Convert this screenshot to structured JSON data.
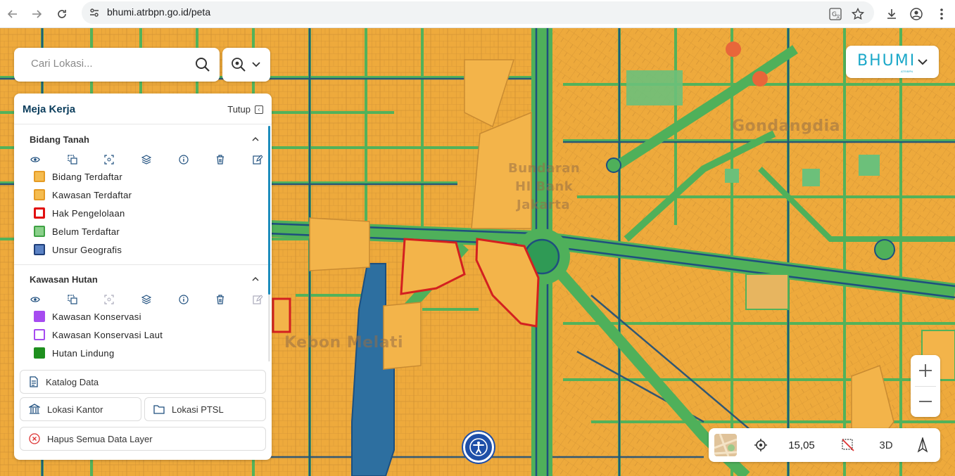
{
  "browser": {
    "url": "bhumi.atrbpn.go.id/peta"
  },
  "search": {
    "placeholder": "Cari Lokasi..."
  },
  "panel": {
    "title": "Meja Kerja",
    "close_label": "Tutup",
    "sections": [
      {
        "title": "Bidang Tanah",
        "items": [
          {
            "label": "Bidang Terdaftar",
            "color": "#f5bc4f",
            "border": "#e59b25"
          },
          {
            "label": "Kawasan Terdaftar",
            "color": "#f5bc4f",
            "border": "#e59b25"
          },
          {
            "label": "Hak Pengelolaan",
            "color": "#ffffff",
            "border": "#e10f0f"
          },
          {
            "label": "Belum Terdaftar",
            "color": "#8ad08a",
            "border": "#3fa244"
          },
          {
            "label": "Unsur Geografis",
            "color": "#5b82c4",
            "border": "#1f3f7a"
          }
        ]
      },
      {
        "title": "Kawasan Hutan",
        "items": [
          {
            "label": "Kawasan Konservasi",
            "color": "#a64bf0",
            "border": "#a64bf0"
          },
          {
            "label": "Kawasan Konservasi Laut",
            "color": "#ffffff",
            "border": "#a64bf0"
          },
          {
            "label": "Hutan Lindung",
            "color": "#1e8f1e",
            "border": "#1e8f1e"
          }
        ]
      }
    ],
    "buttons": {
      "katalog": "Katalog Data",
      "kantor": "Lokasi Kantor",
      "ptsl": "Lokasi PTSL",
      "hapus": "Hapus Semua Data Layer"
    }
  },
  "brand": {
    "name": "BHUMI",
    "sub": "ATR/BPN"
  },
  "map_labels": {
    "area1": "Bundaran",
    "area2": "HI Bank",
    "area3": "Jakarta",
    "area4": "Kebon Melati",
    "area5": "Gondangdia"
  },
  "status": {
    "zoom_level": "15,05",
    "mode_3d": "3D"
  },
  "colors": {
    "parcel": "#eda93f",
    "road": "#5fb760",
    "water": "#2d6fa0",
    "accent": "#1ba8c9"
  }
}
